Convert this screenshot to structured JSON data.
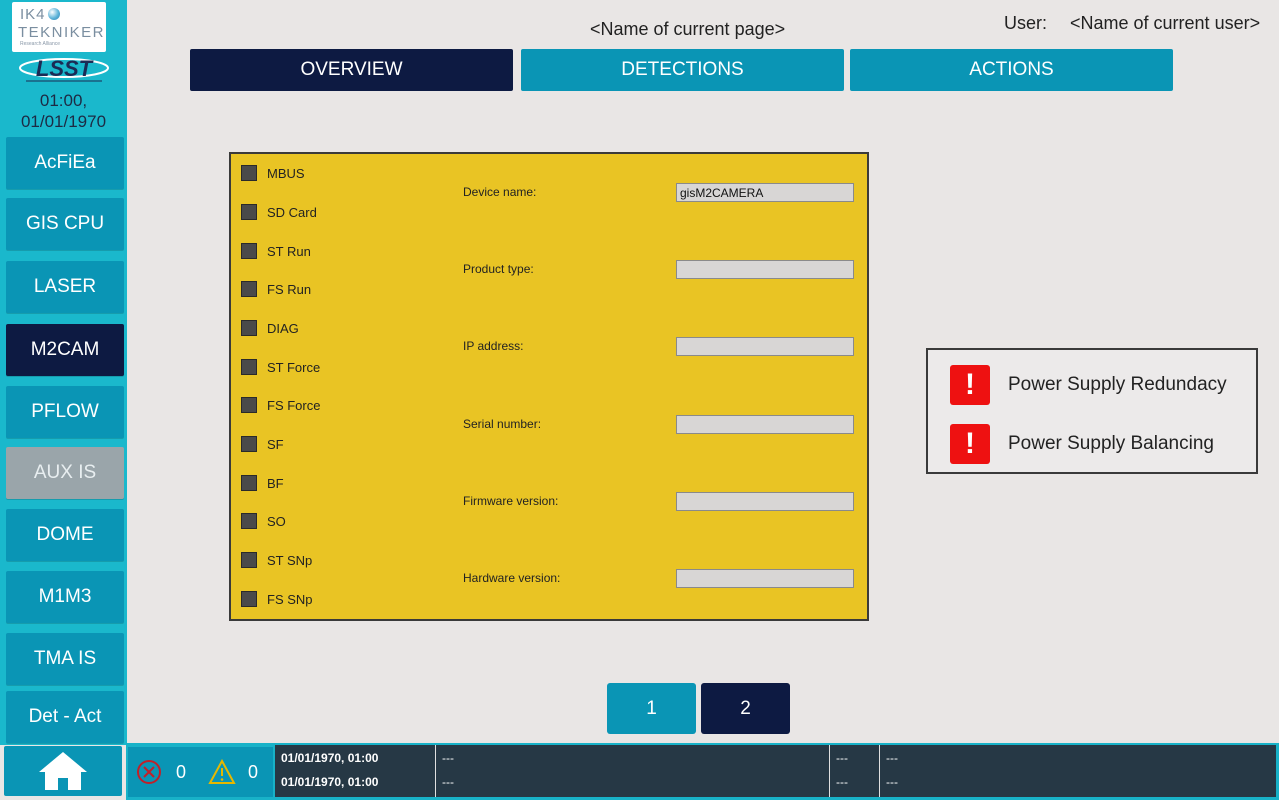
{
  "sidebar": {
    "logo_ik4": {
      "line1": "IK4",
      "line2": "TEKNIKER",
      "line3": "Research Alliance"
    },
    "logo_lsst": "LSST",
    "clock_time": "01:00,",
    "clock_date": "01/01/1970",
    "items": [
      {
        "label": "AcFiEa"
      },
      {
        "label": "GIS CPU"
      },
      {
        "label": "LASER"
      },
      {
        "label": "M2CAM"
      },
      {
        "label": "PFLOW"
      },
      {
        "label": "AUX IS"
      },
      {
        "label": "DOME"
      },
      {
        "label": "M1M3"
      },
      {
        "label": "TMA IS"
      },
      {
        "label": "Det - Act"
      }
    ],
    "home_icon": "home-icon"
  },
  "header": {
    "page_name": "<Name of current page>",
    "user_label": "User:",
    "user_name": "<Name of current user>"
  },
  "tabs": [
    {
      "label": "OVERVIEW"
    },
    {
      "label": "DETECTIONS"
    },
    {
      "label": "ACTIONS"
    }
  ],
  "device": {
    "leds": [
      {
        "label": "MBUS"
      },
      {
        "label": "SD Card"
      },
      {
        "label": "ST Run"
      },
      {
        "label": "FS Run"
      },
      {
        "label": "DIAG"
      },
      {
        "label": "ST Force"
      },
      {
        "label": "FS Force"
      },
      {
        "label": "SF"
      },
      {
        "label": "BF"
      },
      {
        "label": "SO"
      },
      {
        "label": "ST SNp"
      },
      {
        "label": "FS SNp"
      }
    ],
    "fields": [
      {
        "label": "Device name:",
        "value": "gisM2CAMERA"
      },
      {
        "label": "Product type:",
        "value": ""
      },
      {
        "label": "IP address:",
        "value": ""
      },
      {
        "label": "Serial number:",
        "value": ""
      },
      {
        "label": "Firmware version:",
        "value": ""
      },
      {
        "label": "Hardware version:",
        "value": ""
      }
    ]
  },
  "alarms": [
    {
      "icon": "!",
      "text": "Power Supply Redundacy"
    },
    {
      "icon": "!",
      "text": "Power Supply Balancing"
    }
  ],
  "pagination": {
    "pages": [
      "1",
      "2"
    ],
    "current": "2"
  },
  "status_bar": {
    "error_count": "0",
    "warning_count": "0",
    "log": [
      {
        "timestamp": "01/01/1970, 01:00",
        "message": "---",
        "col3": "---",
        "col4": "---"
      },
      {
        "timestamp": "01/01/1970, 01:00",
        "message": "---",
        "col3": "---",
        "col4": "---"
      }
    ]
  },
  "colors": {
    "sidebar_bg": "#1ab8cc",
    "button": "#0a95b5",
    "active": "#0d1a42",
    "panel": "#e9c424",
    "alarm": "#ee1111"
  }
}
